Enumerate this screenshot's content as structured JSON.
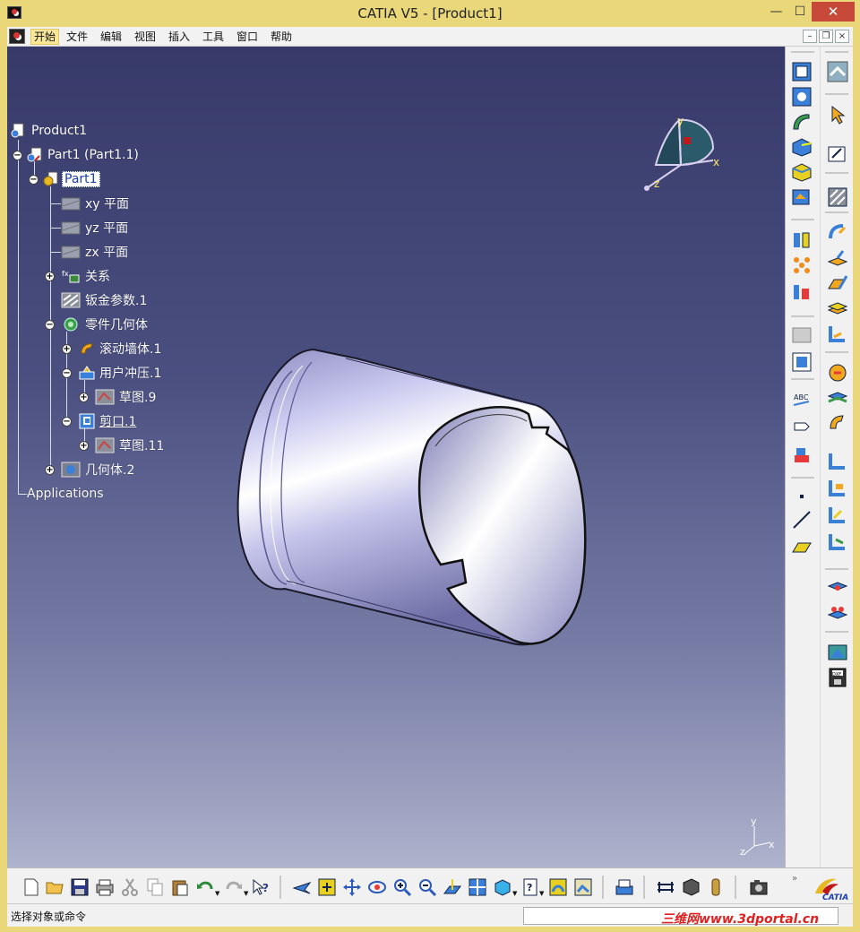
{
  "window": {
    "title": "CATIA V5 - [Product1]"
  },
  "menu": {
    "items": [
      {
        "label": "开始",
        "active": true
      },
      {
        "label": "文件"
      },
      {
        "label": "编辑"
      },
      {
        "label": "视图"
      },
      {
        "label": "插入"
      },
      {
        "label": "工具"
      },
      {
        "label": "窗口"
      },
      {
        "label": "帮助"
      }
    ]
  },
  "tree": {
    "nodes": [
      {
        "label": "Product1",
        "icon": "product-icon"
      },
      {
        "label": "Part1 (Part1.1)",
        "icon": "part-instance-icon"
      },
      {
        "label": "Part1",
        "icon": "part-icon",
        "selected": true
      },
      {
        "label": "xy 平面",
        "icon": "plane-icon"
      },
      {
        "label": "yz 平面",
        "icon": "plane-icon"
      },
      {
        "label": "zx 平面",
        "icon": "plane-icon"
      },
      {
        "label": "关系",
        "icon": "relations-icon"
      },
      {
        "label": "钣金参数.1",
        "icon": "sheetmetal-params-icon"
      },
      {
        "label": "零件几何体",
        "icon": "part-body-icon"
      },
      {
        "label": "滚动墙体.1",
        "icon": "rolled-wall-icon"
      },
      {
        "label": "用户冲压.1",
        "icon": "user-stamp-icon"
      },
      {
        "label": "草图.9",
        "icon": "sketch-icon"
      },
      {
        "label": "剪口.1",
        "icon": "cutout-icon"
      },
      {
        "label": "草图.11",
        "icon": "sketch-icon"
      },
      {
        "label": "几何体.2",
        "icon": "body-icon"
      },
      {
        "label": "Applications",
        "icon": ""
      }
    ]
  },
  "compass": {
    "x": "x",
    "y": "y",
    "z": "z"
  },
  "mini_axis": {
    "x": "x",
    "y": "y",
    "z": "z"
  },
  "status": {
    "prompt": "选择对象或命令",
    "command_value": "",
    "watermark": "三维网www.3dportal.cn"
  },
  "colors": {
    "titlebar": "#e9d77a",
    "viewport_top": "#373a69",
    "viewport_bottom": "#aeb2cc",
    "part_surface": "#c9c8ef"
  }
}
